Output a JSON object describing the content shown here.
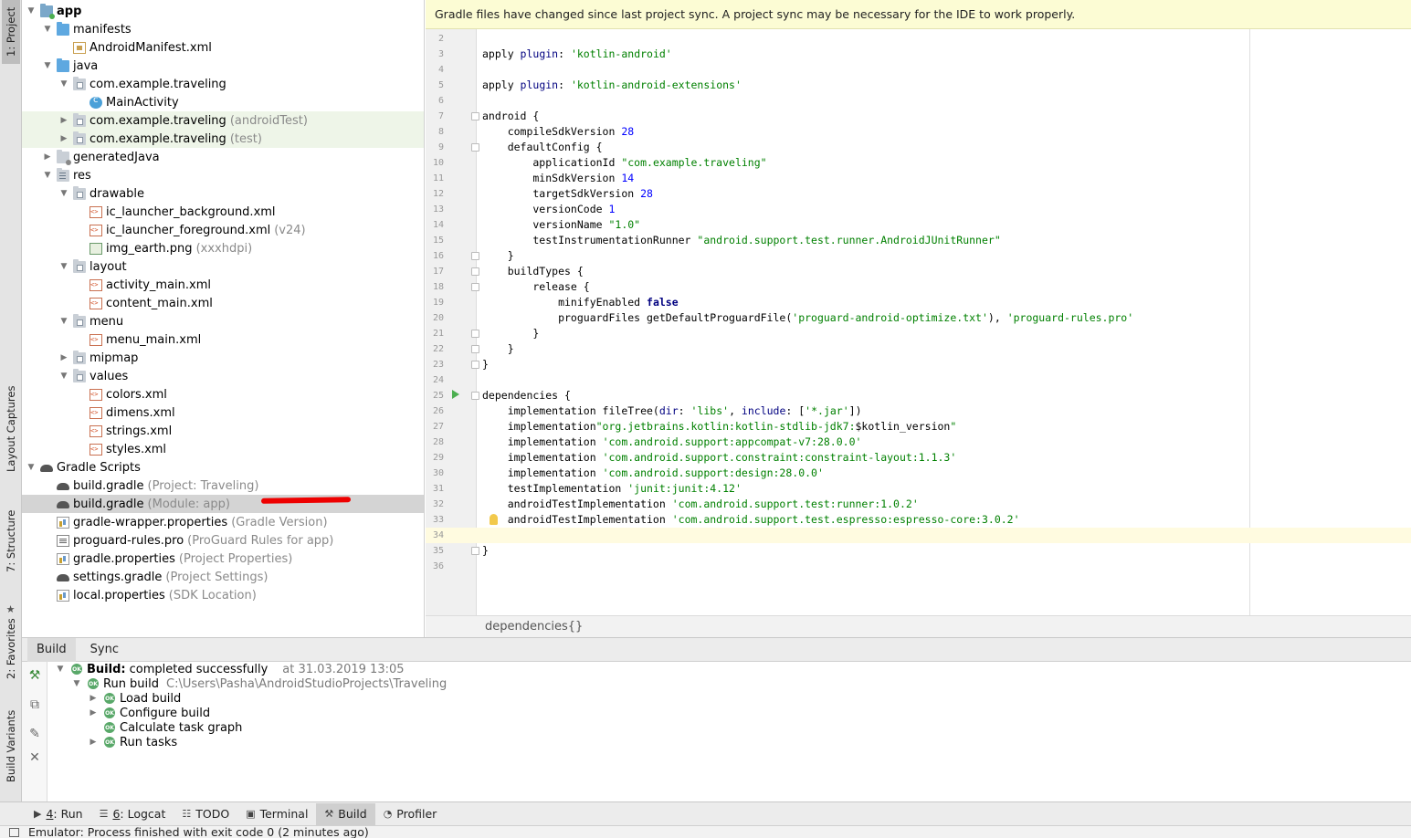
{
  "left_strip": {
    "project_tab": "1: Project",
    "layout_captures_tab": "Layout Captures",
    "structure_tab": "7: Structure",
    "favorites_tab": "2: Favorites",
    "build_variants_tab": "Build Variants"
  },
  "tree": {
    "rows": [
      {
        "indent": 0,
        "arrow": "open",
        "icon": "app",
        "name": "app",
        "sub": "",
        "bold": true,
        "bg": ""
      },
      {
        "indent": 1,
        "arrow": "open",
        "icon": "folder-blue",
        "name": "manifests",
        "sub": "",
        "bold": false,
        "bg": ""
      },
      {
        "indent": 2,
        "arrow": "",
        "icon": "manifest",
        "name": "AndroidManifest.xml",
        "sub": "",
        "bold": false,
        "bg": ""
      },
      {
        "indent": 1,
        "arrow": "open",
        "icon": "java",
        "name": "java",
        "sub": "",
        "bold": false,
        "bg": ""
      },
      {
        "indent": 2,
        "arrow": "open",
        "icon": "pkg",
        "name": "com.example.traveling",
        "sub": "",
        "bold": false,
        "bg": ""
      },
      {
        "indent": 3,
        "arrow": "",
        "icon": "class",
        "name": "MainActivity",
        "sub": "",
        "bold": false,
        "bg": ""
      },
      {
        "indent": 2,
        "arrow": "closed",
        "icon": "pkg",
        "name": "com.example.traveling",
        "sub": "(androidTest)",
        "bold": false,
        "bg": "green"
      },
      {
        "indent": 2,
        "arrow": "closed",
        "icon": "pkg",
        "name": "com.example.traveling",
        "sub": "(test)",
        "bold": false,
        "bg": "green"
      },
      {
        "indent": 1,
        "arrow": "closed",
        "icon": "gen",
        "name": "generatedJava",
        "sub": "",
        "bold": false,
        "bg": ""
      },
      {
        "indent": 1,
        "arrow": "open",
        "icon": "res",
        "name": "res",
        "sub": "",
        "bold": false,
        "bg": ""
      },
      {
        "indent": 2,
        "arrow": "open",
        "icon": "pkg",
        "name": "drawable",
        "sub": "",
        "bold": false,
        "bg": ""
      },
      {
        "indent": 3,
        "arrow": "",
        "icon": "xml",
        "name": "ic_launcher_background.xml",
        "sub": "",
        "bold": false,
        "bg": ""
      },
      {
        "indent": 3,
        "arrow": "",
        "icon": "xml",
        "name": "ic_launcher_foreground.xml",
        "sub": "(v24)",
        "bold": false,
        "bg": ""
      },
      {
        "indent": 3,
        "arrow": "",
        "icon": "png",
        "name": "img_earth.png",
        "sub": "(xxxhdpi)",
        "bold": false,
        "bg": ""
      },
      {
        "indent": 2,
        "arrow": "open",
        "icon": "pkg",
        "name": "layout",
        "sub": "",
        "bold": false,
        "bg": ""
      },
      {
        "indent": 3,
        "arrow": "",
        "icon": "xml",
        "name": "activity_main.xml",
        "sub": "",
        "bold": false,
        "bg": ""
      },
      {
        "indent": 3,
        "arrow": "",
        "icon": "xml",
        "name": "content_main.xml",
        "sub": "",
        "bold": false,
        "bg": ""
      },
      {
        "indent": 2,
        "arrow": "open",
        "icon": "pkg",
        "name": "menu",
        "sub": "",
        "bold": false,
        "bg": ""
      },
      {
        "indent": 3,
        "arrow": "",
        "icon": "xml",
        "name": "menu_main.xml",
        "sub": "",
        "bold": false,
        "bg": ""
      },
      {
        "indent": 2,
        "arrow": "closed",
        "icon": "pkg",
        "name": "mipmap",
        "sub": "",
        "bold": false,
        "bg": ""
      },
      {
        "indent": 2,
        "arrow": "open",
        "icon": "pkg",
        "name": "values",
        "sub": "",
        "bold": false,
        "bg": ""
      },
      {
        "indent": 3,
        "arrow": "",
        "icon": "xml",
        "name": "colors.xml",
        "sub": "",
        "bold": false,
        "bg": ""
      },
      {
        "indent": 3,
        "arrow": "",
        "icon": "xml",
        "name": "dimens.xml",
        "sub": "",
        "bold": false,
        "bg": ""
      },
      {
        "indent": 3,
        "arrow": "",
        "icon": "xml",
        "name": "strings.xml",
        "sub": "",
        "bold": false,
        "bg": ""
      },
      {
        "indent": 3,
        "arrow": "",
        "icon": "xml",
        "name": "styles.xml",
        "sub": "",
        "bold": false,
        "bg": ""
      },
      {
        "indent": 0,
        "arrow": "open",
        "icon": "gradle",
        "name": "Gradle Scripts",
        "sub": "",
        "bold": false,
        "bg": ""
      },
      {
        "indent": 1,
        "arrow": "",
        "icon": "gradle",
        "name": "build.gradle",
        "sub": "(Project: Traveling)",
        "bold": false,
        "bg": ""
      },
      {
        "indent": 1,
        "arrow": "",
        "icon": "gradle",
        "name": "build.gradle",
        "sub": "(Module: app)",
        "bold": false,
        "bg": "selected"
      },
      {
        "indent": 1,
        "arrow": "",
        "icon": "props",
        "name": "gradle-wrapper.properties",
        "sub": "(Gradle Version)",
        "bold": false,
        "bg": ""
      },
      {
        "indent": 1,
        "arrow": "",
        "icon": "pro",
        "name": "proguard-rules.pro",
        "sub": "(ProGuard Rules for app)",
        "bold": false,
        "bg": ""
      },
      {
        "indent": 1,
        "arrow": "",
        "icon": "props",
        "name": "gradle.properties",
        "sub": "(Project Properties)",
        "bold": false,
        "bg": ""
      },
      {
        "indent": 1,
        "arrow": "",
        "icon": "gradle",
        "name": "settings.gradle",
        "sub": "(Project Settings)",
        "bold": false,
        "bg": ""
      },
      {
        "indent": 1,
        "arrow": "",
        "icon": "props",
        "name": "local.properties",
        "sub": "(SDK Location)",
        "bold": false,
        "bg": ""
      }
    ]
  },
  "editor": {
    "banner": "Gradle files have changed since last project sync. A project sync may be necessary for the IDE to work properly.",
    "breadcrumb": "dependencies{}",
    "lines": [
      {
        "n": "2",
        "fold": false,
        "marker": "",
        "tokens": []
      },
      {
        "n": "3",
        "fold": false,
        "marker": "",
        "tokens": [
          [
            "p",
            "apply "
          ],
          [
            "kwn",
            "plugin"
          ],
          [
            "p",
            ": "
          ],
          [
            "s",
            "'kotlin-android'"
          ]
        ]
      },
      {
        "n": "4",
        "fold": false,
        "marker": "",
        "tokens": []
      },
      {
        "n": "5",
        "fold": false,
        "marker": "",
        "tokens": [
          [
            "p",
            "apply "
          ],
          [
            "kwn",
            "plugin"
          ],
          [
            "p",
            ": "
          ],
          [
            "s",
            "'kotlin-android-extensions'"
          ]
        ]
      },
      {
        "n": "6",
        "fold": false,
        "marker": "",
        "tokens": []
      },
      {
        "n": "7",
        "fold": true,
        "marker": "",
        "tokens": [
          [
            "p",
            "android {"
          ]
        ]
      },
      {
        "n": "8",
        "fold": false,
        "marker": "",
        "tokens": [
          [
            "p",
            "    compileSdkVersion "
          ],
          [
            "n",
            "28"
          ]
        ]
      },
      {
        "n": "9",
        "fold": true,
        "marker": "",
        "tokens": [
          [
            "p",
            "    defaultConfig {"
          ]
        ]
      },
      {
        "n": "10",
        "fold": false,
        "marker": "",
        "tokens": [
          [
            "p",
            "        applicationId "
          ],
          [
            "s",
            "\"com.example.traveling\""
          ]
        ]
      },
      {
        "n": "11",
        "fold": false,
        "marker": "",
        "tokens": [
          [
            "p",
            "        minSdkVersion "
          ],
          [
            "n",
            "14"
          ]
        ]
      },
      {
        "n": "12",
        "fold": false,
        "marker": "",
        "tokens": [
          [
            "p",
            "        targetSdkVersion "
          ],
          [
            "n",
            "28"
          ]
        ]
      },
      {
        "n": "13",
        "fold": false,
        "marker": "",
        "tokens": [
          [
            "p",
            "        versionCode "
          ],
          [
            "n",
            "1"
          ]
        ]
      },
      {
        "n": "14",
        "fold": false,
        "marker": "",
        "tokens": [
          [
            "p",
            "        versionName "
          ],
          [
            "s",
            "\"1.0\""
          ]
        ]
      },
      {
        "n": "15",
        "fold": false,
        "marker": "",
        "tokens": [
          [
            "p",
            "        testInstrumentationRunner "
          ],
          [
            "s",
            "\"android.support.test.runner.AndroidJUnitRunner\""
          ]
        ]
      },
      {
        "n": "16",
        "fold": true,
        "marker": "",
        "tokens": [
          [
            "p",
            "    }"
          ]
        ]
      },
      {
        "n": "17",
        "fold": true,
        "marker": "",
        "tokens": [
          [
            "p",
            "    buildTypes {"
          ]
        ]
      },
      {
        "n": "18",
        "fold": true,
        "marker": "",
        "tokens": [
          [
            "p",
            "        release {"
          ]
        ]
      },
      {
        "n": "19",
        "fold": false,
        "marker": "",
        "tokens": [
          [
            "p",
            "            minifyEnabled "
          ],
          [
            "kw",
            "false"
          ]
        ]
      },
      {
        "n": "20",
        "fold": false,
        "marker": "",
        "tokens": [
          [
            "p",
            "            proguardFiles getDefaultProguardFile("
          ],
          [
            "s",
            "'proguard-android-optimize.txt'"
          ],
          [
            "p",
            "), "
          ],
          [
            "s",
            "'proguard-rules.pro'"
          ]
        ]
      },
      {
        "n": "21",
        "fold": true,
        "marker": "",
        "tokens": [
          [
            "p",
            "        }"
          ]
        ]
      },
      {
        "n": "22",
        "fold": true,
        "marker": "",
        "tokens": [
          [
            "p",
            "    }"
          ]
        ]
      },
      {
        "n": "23",
        "fold": true,
        "marker": "",
        "tokens": [
          [
            "p",
            "}"
          ]
        ]
      },
      {
        "n": "24",
        "fold": false,
        "marker": "",
        "tokens": []
      },
      {
        "n": "25",
        "fold": true,
        "marker": "run",
        "tokens": [
          [
            "p",
            "dependencies {"
          ]
        ]
      },
      {
        "n": "26",
        "fold": false,
        "marker": "",
        "tokens": [
          [
            "p",
            "    implementation fileTree("
          ],
          [
            "kwn",
            "dir"
          ],
          [
            "p",
            ": "
          ],
          [
            "s",
            "'libs'"
          ],
          [
            "p",
            ", "
          ],
          [
            "kwn",
            "include"
          ],
          [
            "p",
            ": ["
          ],
          [
            "s",
            "'*.jar'"
          ],
          [
            "p",
            "])"
          ]
        ]
      },
      {
        "n": "27",
        "fold": false,
        "marker": "",
        "tokens": [
          [
            "p",
            "    implementation"
          ],
          [
            "s",
            "\"org.jetbrains.kotlin:kotlin-stdlib-jdk7:"
          ],
          [
            "p",
            "$kotlin_version"
          ],
          [
            "s",
            "\""
          ]
        ]
      },
      {
        "n": "28",
        "fold": false,
        "marker": "",
        "tokens": [
          [
            "p",
            "    implementation "
          ],
          [
            "s",
            "'com.android.support:appcompat-v7:28.0.0'"
          ]
        ]
      },
      {
        "n": "29",
        "fold": false,
        "marker": "",
        "tokens": [
          [
            "p",
            "    implementation "
          ],
          [
            "s",
            "'com.android.support.constraint:constraint-layout:1.1.3'"
          ]
        ]
      },
      {
        "n": "30",
        "fold": false,
        "marker": "",
        "tokens": [
          [
            "p",
            "    implementation "
          ],
          [
            "s",
            "'com.android.support:design:28.0.0'"
          ]
        ]
      },
      {
        "n": "31",
        "fold": false,
        "marker": "",
        "tokens": [
          [
            "p",
            "    testImplementation "
          ],
          [
            "s",
            "'junit:junit:4.12'"
          ]
        ]
      },
      {
        "n": "32",
        "fold": false,
        "marker": "",
        "tokens": [
          [
            "p",
            "    androidTestImplementation "
          ],
          [
            "s",
            "'com.android.support.test:runner:1.0.2'"
          ]
        ]
      },
      {
        "n": "33",
        "fold": false,
        "marker": "bulb",
        "tokens": [
          [
            "p",
            "    androidTestImplementation "
          ],
          [
            "s",
            "'com.android.support.test.espresso:espresso-core:3.0.2'"
          ]
        ]
      },
      {
        "n": "34",
        "fold": false,
        "marker": "current",
        "tokens": []
      },
      {
        "n": "35",
        "fold": true,
        "marker": "",
        "tokens": [
          [
            "p",
            "}"
          ]
        ]
      },
      {
        "n": "36",
        "fold": false,
        "marker": "",
        "tokens": []
      }
    ]
  },
  "build": {
    "tabs": [
      "Build",
      "Sync"
    ],
    "status_bold": "Build:",
    "status_text": "completed successfully",
    "timestamp": "at 31.03.2019 13:05",
    "run_build": "Run build",
    "run_build_path": "C:\\Users\\Pasha\\AndroidStudioProjects\\Traveling",
    "tasks": [
      "Load build",
      "Configure build",
      "Calculate task graph",
      "Run tasks"
    ],
    "ok_badge": "OK"
  },
  "bottom_tabs": [
    {
      "key": "4",
      "label": ": Run",
      "glyph": "▶"
    },
    {
      "key": "6",
      "label": ": Logcat",
      "glyph": "☰"
    },
    {
      "key": "",
      "label": "TODO",
      "glyph": "☷"
    },
    {
      "key": "",
      "label": "Terminal",
      "glyph": "▣"
    },
    {
      "key": "",
      "label": "Build",
      "glyph": "⚒"
    },
    {
      "key": "",
      "label": "Profiler",
      "glyph": "◔"
    }
  ],
  "status_bar": "Emulator: Process finished with exit code 0 (2 minutes ago)"
}
